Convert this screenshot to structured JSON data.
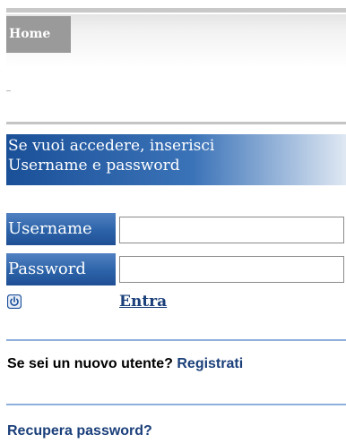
{
  "nav": {
    "home_label": "Home"
  },
  "banner": {
    "line1": "Se vuoi accedere, inserisci",
    "line2": "Username e password"
  },
  "login_form": {
    "username_label": "Username",
    "username_value": "",
    "password_label": "Password",
    "password_value": "",
    "submit_label": "Entra",
    "submit_icon": "power-icon"
  },
  "register": {
    "prompt": "Se sei un nuovo utente?",
    "link_label": "Registrati"
  },
  "recover": {
    "link_label": "Recupera password?"
  },
  "colors": {
    "banner_blue": "#1a5098",
    "link_blue": "#1a3f7a",
    "divider_blue": "#8fb0dc"
  }
}
